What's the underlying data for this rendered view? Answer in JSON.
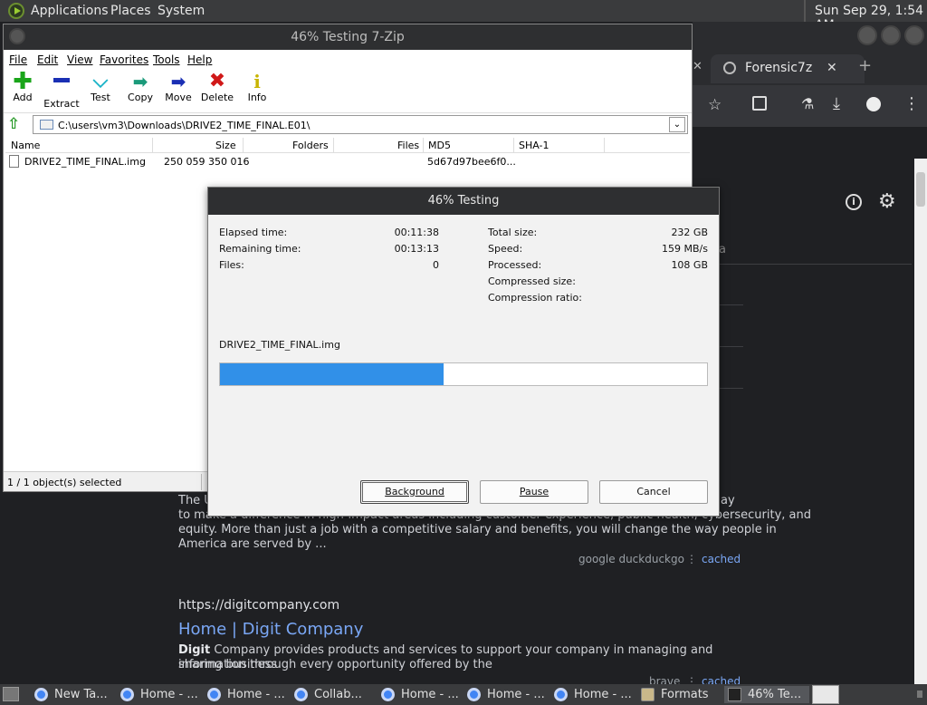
{
  "top_panel": {
    "menus": [
      "Applications",
      "Places",
      "System"
    ],
    "clock": "Sun Sep 29,  1:54 AM"
  },
  "browser": {
    "tab_title": "Forensic7z",
    "new_tab_symbol": "+",
    "close_symbol": "✕",
    "partial_text": "a",
    "result1": {
      "snippet_line1": "The U",
      "snippet_line1_end": "ay",
      "snippet_line2": "to make a difference in high-impact areas including customer experience, public health, cybersecurity, and",
      "snippet_line3": "equity. More than just a job with a competitive salary and benefits, you will change the way people in",
      "snippet_line4": "America are served by ...",
      "sources": "google  duckduckgo",
      "cached": "cached"
    },
    "result2": {
      "url": "https://digitcompany.com",
      "title": "Home | Digit Company",
      "snippet_bold": "Digit",
      "snippet_rest": " Company provides products and services to support your company in managing and sharing business",
      "snippet_line2": "information through every opportunity offered by the",
      "sources": "brave",
      "cached": "cached"
    }
  },
  "zip_window": {
    "title": "46% Testing 7-Zip",
    "menu": [
      "File",
      "Edit",
      "View",
      "Favorites",
      "Tools",
      "Help"
    ],
    "toolbar": [
      {
        "label": "Add",
        "icon": "plus-icon",
        "color": "#1aa51a"
      },
      {
        "label": "Extract",
        "icon": "minus-icon",
        "color": "#1a2fb4"
      },
      {
        "label": "Test",
        "icon": "check-icon",
        "color": "#19b3c7"
      },
      {
        "label": "Copy",
        "icon": "arrow-right-icon",
        "color": "#1a9a7a"
      },
      {
        "label": "Move",
        "icon": "arrow-right-icon",
        "color": "#1a2fb4"
      },
      {
        "label": "Delete",
        "icon": "x-icon",
        "color": "#d01818"
      },
      {
        "label": "Info",
        "icon": "info-icon",
        "color": "#c8b400"
      }
    ],
    "path": "C:\\users\\vm3\\Downloads\\DRIVE2_TIME_FINAL.E01\\",
    "columns": [
      "Name",
      "Size",
      "Folders",
      "Files",
      "MD5",
      "SHA-1"
    ],
    "rows": [
      {
        "name": "DRIVE2_TIME_FINAL.img",
        "size": "250 059 350 016",
        "md5": "5d67d97bee6f0..."
      }
    ],
    "status": "1 / 1 object(s) selected"
  },
  "dialog": {
    "title": "46% Testing",
    "left_stats": [
      {
        "label": "Elapsed time:",
        "value": "00:11:38"
      },
      {
        "label": "Remaining time:",
        "value": "00:13:13"
      },
      {
        "label": "Files:",
        "value": "0"
      }
    ],
    "right_stats": [
      {
        "label": "Total size:",
        "value": "232 GB"
      },
      {
        "label": "Speed:",
        "value": "159 MB/s"
      },
      {
        "label": "Processed:",
        "value": "108 GB"
      },
      {
        "label": "Compressed size:",
        "value": ""
      },
      {
        "label": "Compression ratio:",
        "value": ""
      }
    ],
    "current_file": "DRIVE2_TIME_FINAL.img",
    "progress": 0.46,
    "buttons": {
      "background": "Background",
      "pause": "Pause",
      "cancel": "Cancel"
    }
  },
  "taskbar": {
    "items": [
      "New Ta...",
      "Home - ...",
      "Home - ...",
      "Collab...",
      "Home - ...",
      "Home - ...",
      "Home - ...",
      "Formats",
      "46% Te..."
    ]
  }
}
